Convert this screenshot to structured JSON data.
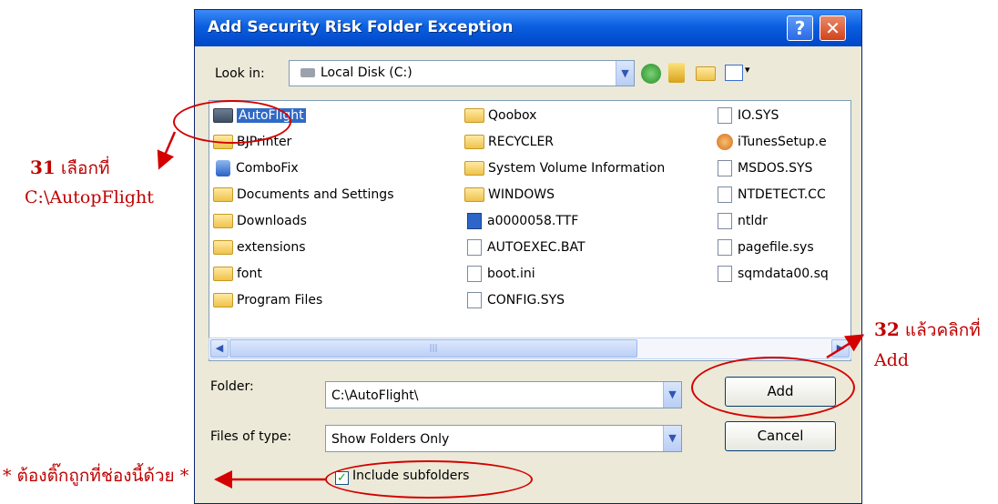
{
  "window": {
    "title": "Add Security Risk Folder Exception",
    "help_label": "?",
    "close_label": "✕"
  },
  "lookin": {
    "label": "Look in:",
    "value": "Local Disk (C:)"
  },
  "files": {
    "col1": [
      "AutoFlight",
      "BJPrinter",
      "ComboFix",
      "Documents and Settings",
      "Downloads",
      "extensions",
      "font",
      "Program Files"
    ],
    "col2": [
      "Qoobox",
      "RECYCLER",
      "System Volume Information",
      "WINDOWS",
      "a0000058.TTF",
      "AUTOEXEC.BAT",
      "boot.ini",
      "CONFIG.SYS"
    ],
    "col3": [
      "IO.SYS",
      "iTunesSetup.e",
      "MSDOS.SYS",
      "NTDETECT.CC",
      "ntldr",
      "pagefile.sys",
      "sqmdata00.sq"
    ]
  },
  "folder": {
    "label": "Folder:",
    "value": "C:\\AutoFlight\\"
  },
  "filetype": {
    "label": "Files of type:",
    "value": "Show Folders Only"
  },
  "buttons": {
    "add": "Add",
    "cancel": "Cancel"
  },
  "checkbox": {
    "label": "Include subfolders",
    "checked": true
  },
  "annotations": {
    "step31_number": "31",
    "step31_text": "เลือกที่",
    "step31_path": "C:\\AutopFlight",
    "step32_number": "32",
    "step32_text": "แล้วคลิกที่",
    "step32_target": "Add",
    "note": "* ต้องติ๊กถูกที่ช่องนี้ด้วย *"
  }
}
